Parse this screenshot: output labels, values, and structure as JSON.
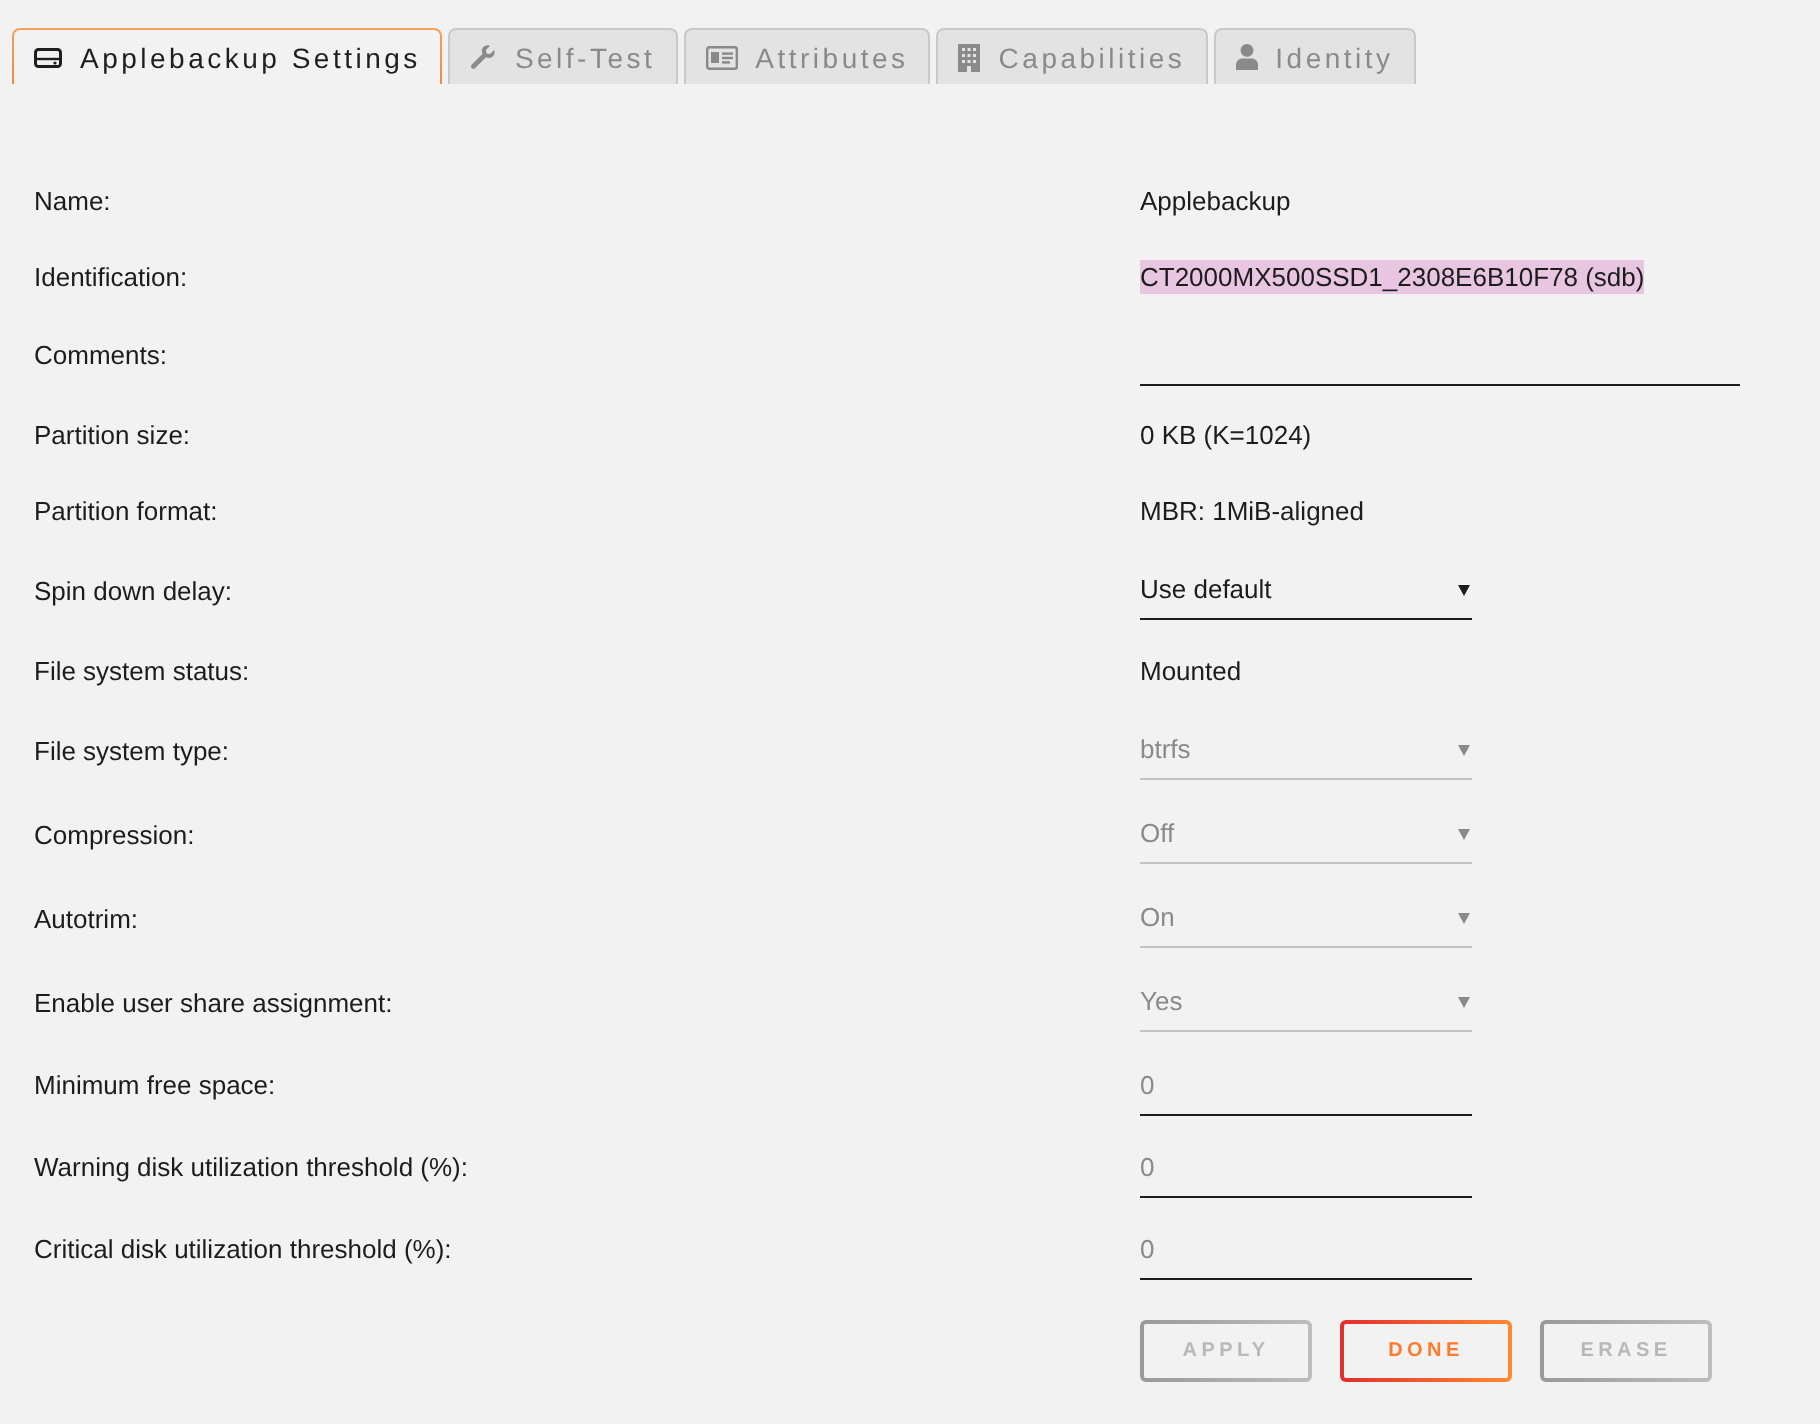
{
  "tabs": [
    {
      "label": "Applebackup Settings",
      "selected": true
    },
    {
      "label": "Self-Test",
      "selected": false
    },
    {
      "label": "Attributes",
      "selected": false
    },
    {
      "label": "Capabilities",
      "selected": false
    },
    {
      "label": "Identity",
      "selected": false
    }
  ],
  "rows": [
    {
      "label": "Name:",
      "kind": "text",
      "value": "Applebackup",
      "highlighted": false
    },
    {
      "label": "Identification:",
      "kind": "text",
      "value": "CT2000MX500SSD1_2308E6B10F78 (sdb)",
      "highlighted": true
    },
    {
      "label": "Comments:",
      "kind": "text-input"
    },
    {
      "label": "Partition size:",
      "kind": "text",
      "value": "0 KB (K=1024)",
      "highlighted": false
    },
    {
      "label": "Partition format:",
      "kind": "text",
      "value": "MBR: 1MiB-aligned",
      "highlighted": false
    },
    {
      "label": "Spin down delay:",
      "kind": "select",
      "value": "Use default",
      "disabled": false
    },
    {
      "label": "File system status:",
      "kind": "text",
      "value": "Mounted",
      "highlighted": false
    },
    {
      "label": "File system type:",
      "kind": "select",
      "value": "btrfs",
      "disabled": true
    },
    {
      "label": "Compression:",
      "kind": "select",
      "value": "Off",
      "disabled": true
    },
    {
      "label": "Autotrim:",
      "kind": "select",
      "value": "On",
      "disabled": true
    },
    {
      "label": "Enable user share assignment:",
      "kind": "select",
      "value": "Yes",
      "disabled": true
    },
    {
      "label": "Minimum free space:",
      "kind": "number-input",
      "placeholder": "0"
    },
    {
      "label": "Warning disk utilization threshold (%):",
      "kind": "number-input",
      "placeholder": "0"
    },
    {
      "label": "Critical disk utilization threshold (%):",
      "kind": "number-input",
      "placeholder": "0"
    }
  ],
  "buttons": [
    {
      "label": "APPLY",
      "disabled": true
    },
    {
      "label": "DONE",
      "disabled": false
    },
    {
      "label": "ERASE",
      "disabled": true
    }
  ]
}
